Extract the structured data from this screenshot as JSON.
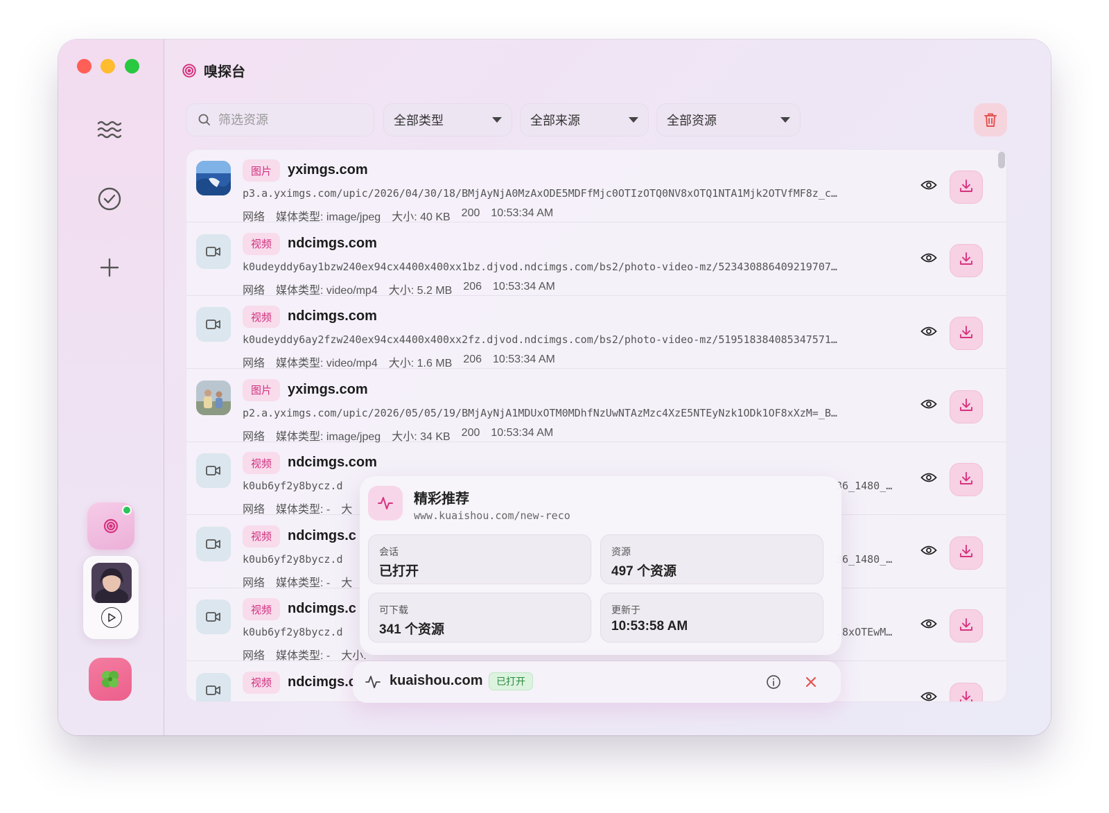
{
  "app": {
    "title": "嗅探台"
  },
  "filters": {
    "search_placeholder": "筛选资源",
    "type_select": "全部类型",
    "source_select": "全部来源",
    "resource_select": "全部资源"
  },
  "rows": [
    {
      "tag": "图片",
      "host": "yximgs.com",
      "url": "p3.a.yximgs.com/upic/2026/04/30/18/BMjAyNjA0MzAxODE5MDFfMjc0OTIzOTQ0NV8xOTQ1NTA1Mjk2OTVfMF8z_c…",
      "source": "网络",
      "media": "媒体类型: image/jpeg",
      "size": "大小: 40 KB",
      "status": "200",
      "time": "10:53:34 AM"
    },
    {
      "tag": "视频",
      "host": "ndcimgs.com",
      "url": "k0udeyddy6ay1bzw240ex94cx4400x400xx1bz.djvod.ndcimgs.com/bs2/photo-video-mz/523430886409219707…",
      "source": "网络",
      "media": "媒体类型: video/mp4",
      "size": "大小: 5.2 MB",
      "status": "206",
      "time": "10:53:34 AM"
    },
    {
      "tag": "视频",
      "host": "ndcimgs.com",
      "url": "k0udeyddy6ay2fzw240ex94cx4400x400xx2fz.djvod.ndcimgs.com/bs2/photo-video-mz/519518384085347571…",
      "source": "网络",
      "media": "媒体类型: video/mp4",
      "size": "大小: 1.6 MB",
      "status": "206",
      "time": "10:53:34 AM"
    },
    {
      "tag": "图片",
      "host": "yximgs.com",
      "url": "p2.a.yximgs.com/upic/2026/05/05/19/BMjAyNjA1MDUxOTM0MDhfNzUwNTAzMzc4XzE5NTEyNzk1ODk1OF8xXzM=_B…",
      "source": "网络",
      "media": "媒体类型: image/jpeg",
      "size": "大小: 34 KB",
      "status": "200",
      "time": "10:53:34 AM"
    },
    {
      "tag": "视频",
      "host": "ndcimgs.com",
      "url": "k0ub6yf2y8bycz.d",
      "url_tail": "36_1480_…",
      "source": "网络",
      "media": "媒体类型: -",
      "size": "大",
      "status": "",
      "time": ""
    },
    {
      "tag": "视频",
      "host": "ndcimgs.c",
      "url": "k0ub6yf2y8bycz.d",
      "url_tail": "36_1480_…",
      "source": "网络",
      "media": "媒体类型: -",
      "size": "大",
      "status": "",
      "time": ""
    },
    {
      "tag": "视频",
      "host": "ndcimgs.c",
      "url": "k0ub6yf2y8bycz.d",
      "url_tail": ".8xOTEwM…",
      "source": "网络",
      "media": "媒体类型: -",
      "size": "大小.",
      "status": "",
      "time": ""
    },
    {
      "tag": "视频",
      "host": "ndcimgs.c",
      "url": "",
      "url_tail": "",
      "source": "",
      "media": "",
      "size": "",
      "status": "",
      "time": ""
    }
  ],
  "popover": {
    "title": "精彩推荐",
    "url": "www.kuaishou.com/new-reco",
    "stats": [
      {
        "label": "会话",
        "value": "已打开"
      },
      {
        "label": "资源",
        "value": "497 个资源"
      },
      {
        "label": "可下载",
        "value": "341 个资源"
      },
      {
        "label": "更新于",
        "value": "10:53:58 AM"
      }
    ]
  },
  "session_bar": {
    "host": "kuaishou.com",
    "status": "已打开"
  },
  "icons": {
    "brand": "radar-icon",
    "nav": [
      "waves-icon",
      "check-circle-icon",
      "plus-icon"
    ],
    "row_actions": [
      "eye-icon",
      "download-icon"
    ],
    "trash": "trash-icon",
    "activity": "activity-icon",
    "info": "info-icon",
    "close": "close-icon"
  },
  "colors": {
    "accent": "#d0317f",
    "accent_bg": "#f8dcec",
    "success": "#2a8a3e",
    "danger": "#e0524f"
  }
}
